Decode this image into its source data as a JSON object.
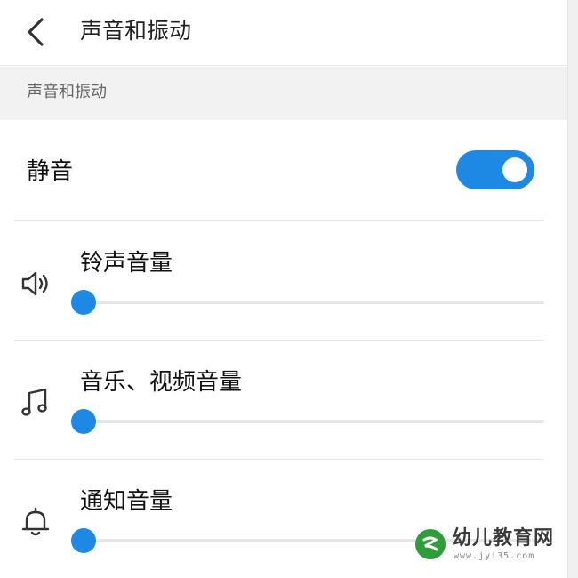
{
  "header": {
    "title": "声音和振动",
    "back_icon": "chevron-left-icon"
  },
  "section": {
    "title": "声音和振动"
  },
  "mute": {
    "label": "静音",
    "enabled": true
  },
  "volumes": [
    {
      "label": "铃声音量",
      "icon": "speaker-icon",
      "level": 0
    },
    {
      "label": "音乐、视频音量",
      "icon": "music-note-icon",
      "level": 0
    },
    {
      "label": "通知音量",
      "icon": "bell-icon",
      "level": 0
    }
  ],
  "colors": {
    "accent": "#1e88e5",
    "track": "#e6e6e6",
    "section_bg": "#f2f2f2"
  },
  "watermark": {
    "name": "幼儿教育网",
    "url": "www.jyi35.com"
  }
}
